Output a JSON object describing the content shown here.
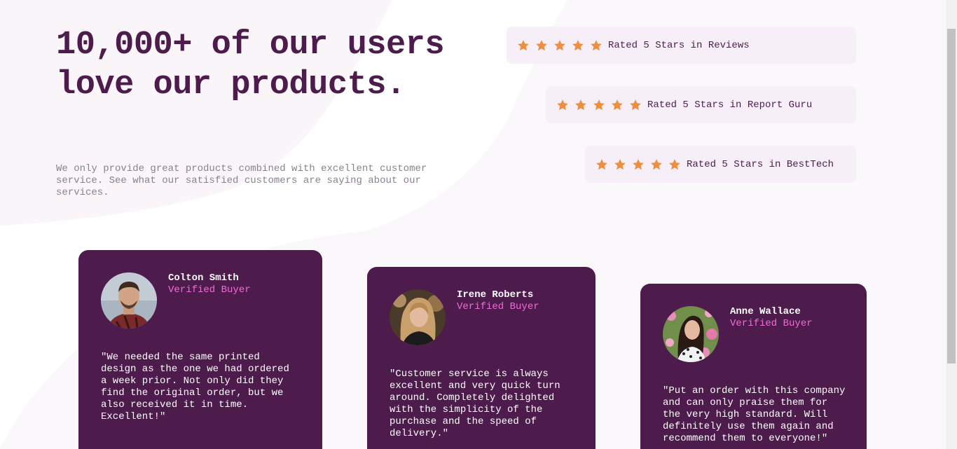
{
  "hero": {
    "title": "10,000+ of our users love our products.",
    "description": "We only provide great products combined with excellent customer service. See what our satisfied customers are saying about our services."
  },
  "ratings": [
    {
      "label": "Rated 5 Stars in Reviews",
      "stars": 5
    },
    {
      "label": "Rated 5 Stars in Report Guru",
      "stars": 5
    },
    {
      "label": "Rated 5 Stars in BestTech",
      "stars": 5
    }
  ],
  "testimonials": [
    {
      "name": "Colton Smith",
      "role": "Verified Buyer",
      "quote": "\"We needed the same printed design as the one we had ordered a week prior. Not only did they find the original order, but we also received it in time. Excellent!\""
    },
    {
      "name": "Irene Roberts",
      "role": "Verified Buyer",
      "quote": "\"Customer service is always excellent and very quick turn around. Completely delighted with the simplicity of the purchase and the speed of delivery.\""
    },
    {
      "name": "Anne Wallace",
      "role": "Verified Buyer",
      "quote": "\"Put an order with this company and can only praise them for the very high standard. Will definitely use them again and recommend them to everyone!\""
    }
  ],
  "colors": {
    "primary": "#4d1c4c",
    "accent_pink": "#f06bd8",
    "star": "#ee8e3e",
    "rating_bg": "#f6eff7",
    "muted_text": "#8b7f8f"
  },
  "icons": {
    "rating_star": "star-icon"
  }
}
